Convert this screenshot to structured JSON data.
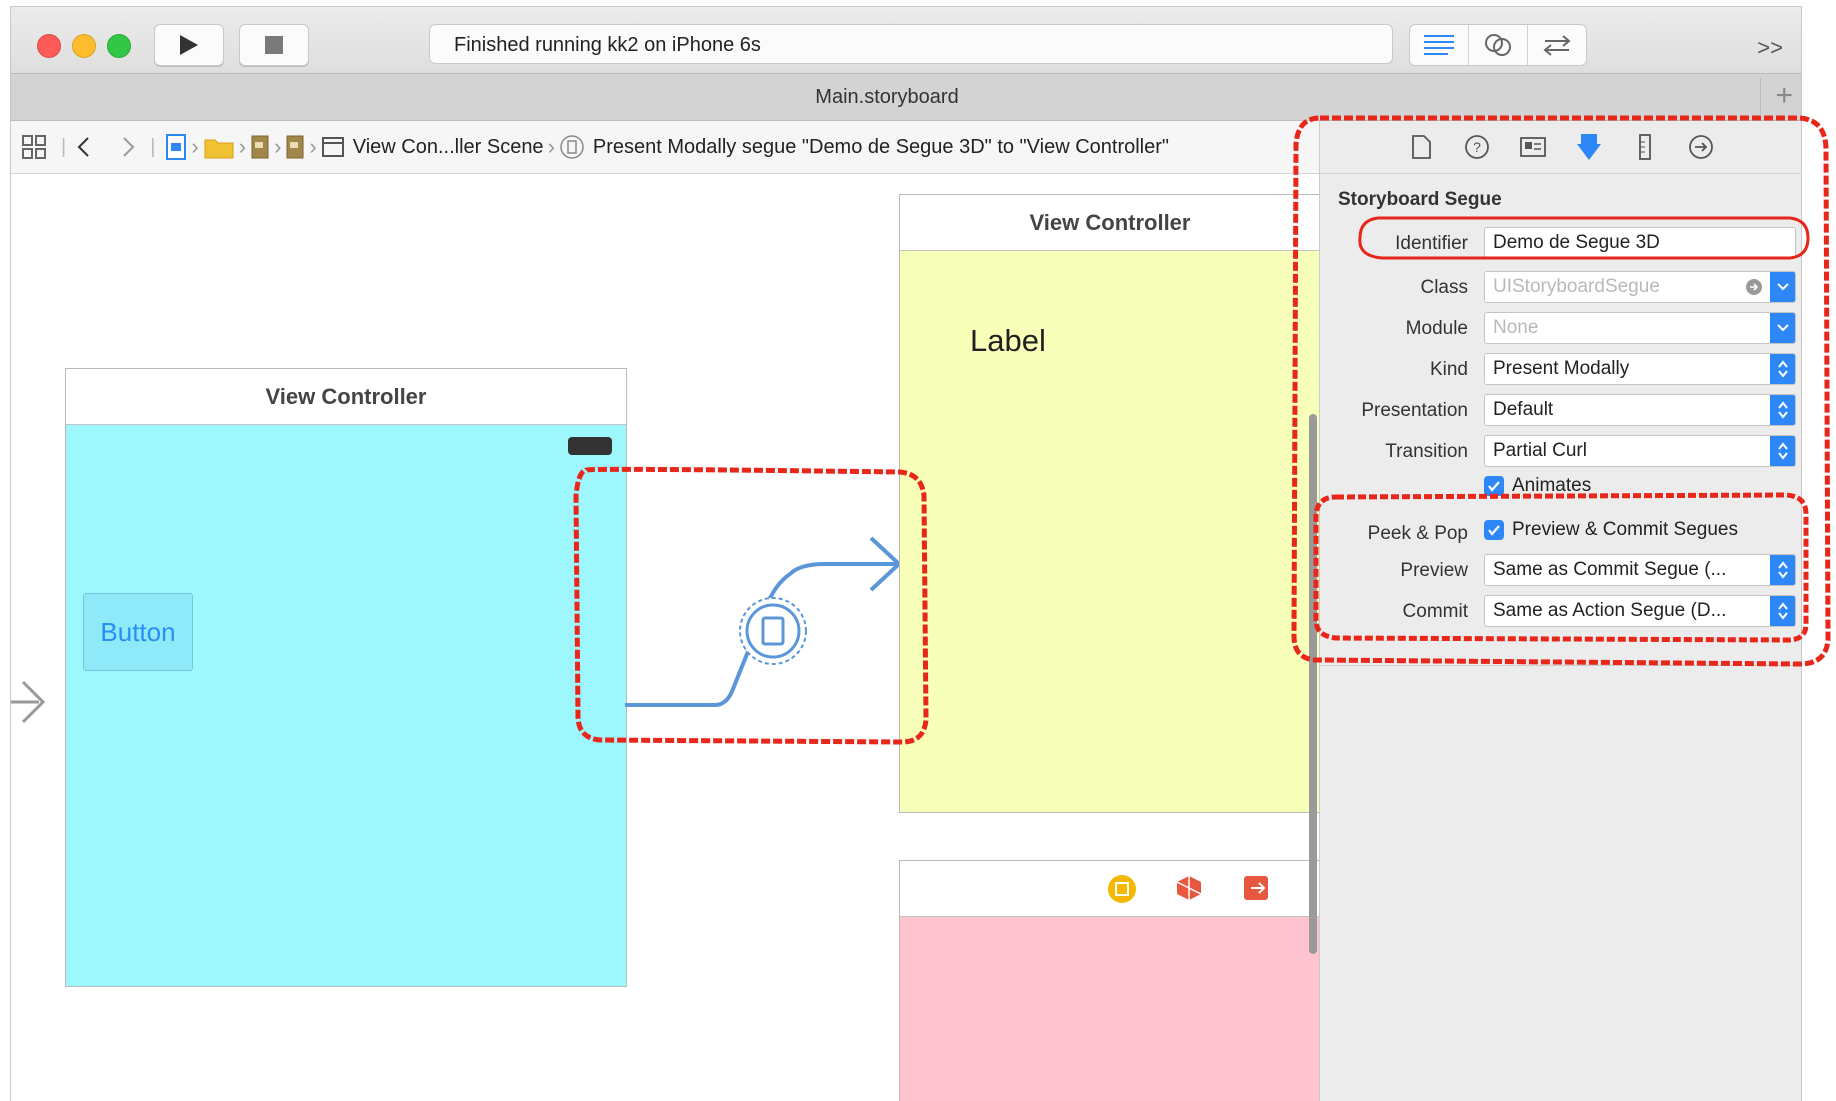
{
  "toolbar": {
    "status": "Finished running kk2 on iPhone 6s",
    "overflow": ">>"
  },
  "tabbar": {
    "title": "Main.storyboard",
    "plus": "+"
  },
  "jumpbar": {
    "scene": "View Con...ller Scene",
    "segue": "Present Modally segue \"Demo de Segue 3D\" to \"View Controller\""
  },
  "canvas": {
    "vc1_title": "View Controller",
    "button_label": "Button",
    "vc2_title": "View Controller",
    "label_text": "Label"
  },
  "inspector": {
    "section": "Storyboard Segue",
    "identifier_label": "Identifier",
    "identifier_value": "Demo de Segue 3D",
    "class_label": "Class",
    "class_placeholder": "UIStoryboardSegue",
    "module_label": "Module",
    "module_placeholder": "None",
    "kind_label": "Kind",
    "kind_value": "Present Modally",
    "presentation_label": "Presentation",
    "presentation_value": "Default",
    "transition_label": "Transition",
    "transition_value": "Partial Curl",
    "animates_label": "Animates",
    "peekpop_label": "Peek & Pop",
    "peekpop_check_label": "Preview & Commit Segues",
    "preview_label": "Preview",
    "preview_value": "Same as Commit Segue (...",
    "commit_label": "Commit",
    "commit_value": "Same as Action Segue (D..."
  },
  "colors": {
    "accent": "#2e87f6",
    "annotation": "#e8261a",
    "vc1_bg": "#9ef7fd",
    "vc2_bg": "#f7ffb8",
    "vc3_bg": "#ffc4cf",
    "segue_line": "#5b97d8"
  }
}
